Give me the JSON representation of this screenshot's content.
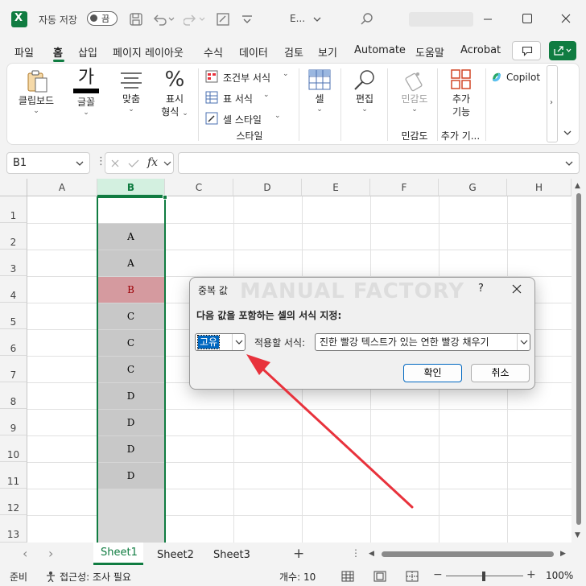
{
  "titlebar": {
    "autosave_label": "자동 저장",
    "autosave_state": "끔",
    "filename": "E...",
    "search_icon": "search-icon"
  },
  "tabs": [
    "파일",
    "홈",
    "삽입",
    "페이지 레이아웃",
    "수식",
    "데이터",
    "검토",
    "보기",
    "Automate",
    "도움말",
    "Acrobat"
  ],
  "active_tab": "홈",
  "ribbon": {
    "clipboard": "클립보드",
    "font": "글꼴",
    "alignment": "맞춤",
    "number_line1": "표시",
    "number_line2": "형식",
    "conditional_format": "조건부 서식",
    "table_format": "표 서식",
    "cell_style": "셀 스타일",
    "style_group": "스타일",
    "cells": "셀",
    "editing": "편집",
    "sensitivity": "민감도",
    "sensitivity_group": "민감도",
    "addins_line1": "추가",
    "addins_line2": "기능",
    "addins_group": "추가 기...",
    "copilot": "Copilot"
  },
  "namebox": {
    "value": "B1"
  },
  "fx_label": "fx",
  "formula": {
    "value": ""
  },
  "columns": [
    "A",
    "B",
    "C",
    "D",
    "E",
    "F",
    "G",
    "H"
  ],
  "selected_column": "B",
  "rows": [
    "1",
    "2",
    "3",
    "4",
    "5",
    "6",
    "7",
    "8",
    "9",
    "10",
    "11",
    "12",
    "13"
  ],
  "column_b_values": [
    "",
    "A",
    "A",
    "B",
    "C",
    "C",
    "C",
    "D",
    "D",
    "D",
    "D",
    "",
    ""
  ],
  "duplicate_highlight_color": "#d59a9f",
  "dialog": {
    "title": "중복 값",
    "help": "?",
    "heading": "다음 값을 포함하는 셀의 서식 지정:",
    "type_value": "고유",
    "apply_label": "적용할 서식:",
    "format_value": "진한 빨강 텍스트가 있는 연한 빨강 채우기",
    "ok": "확인",
    "cancel": "취소",
    "watermark": "MANUAL FACTORY"
  },
  "sheets": [
    "Sheet1",
    "Sheet2",
    "Sheet3"
  ],
  "active_sheet": "Sheet1",
  "status": {
    "ready": "준비",
    "accessibility": "접근성: 조사 필요",
    "count": "개수: 10",
    "zoom": "100%"
  },
  "accent_color": "#107c41",
  "annotation_arrow_color": "#e8323c"
}
